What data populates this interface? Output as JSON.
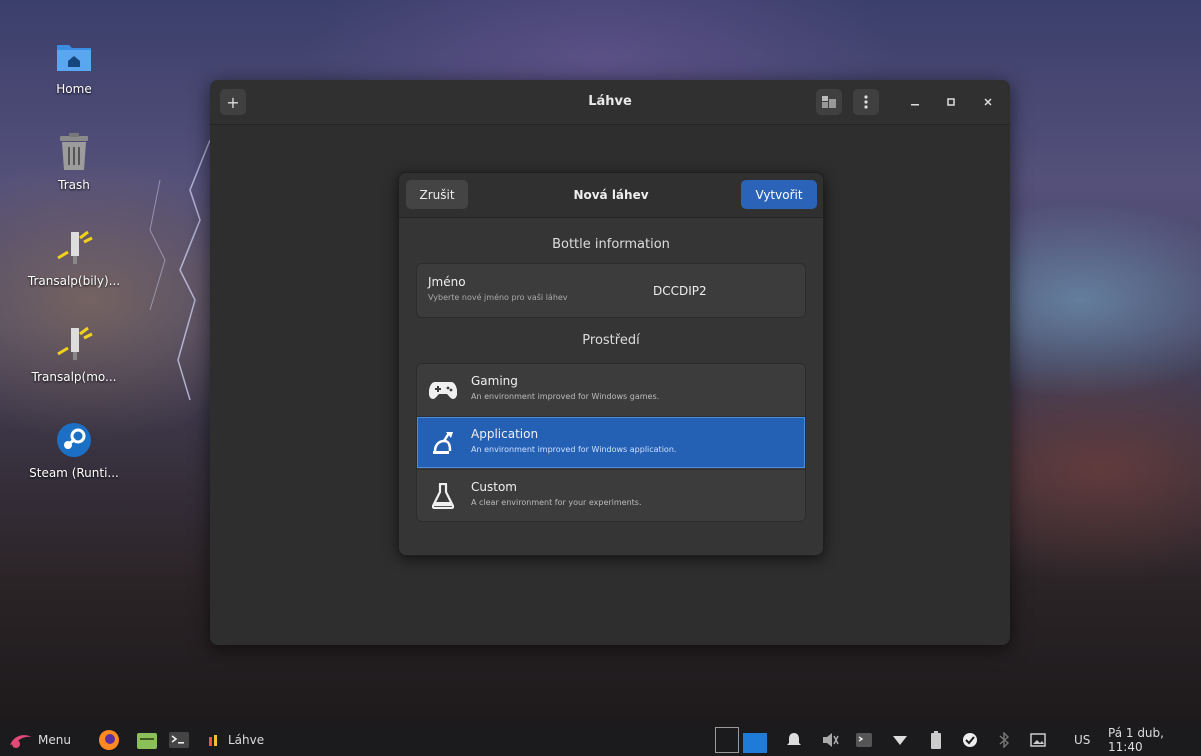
{
  "desktop": {
    "icons": [
      {
        "label": "Home",
        "icon": "home-folder-icon"
      },
      {
        "label": "Trash",
        "icon": "trash-icon"
      },
      {
        "label": "Transalp(bily)...",
        "icon": "transalp-icon"
      },
      {
        "label": "Transalp(mo...",
        "icon": "transalp-icon"
      },
      {
        "label": "Steam (Runti...",
        "icon": "steam-icon"
      }
    ]
  },
  "window": {
    "title": "Láhve",
    "add_button": "+"
  },
  "dialog": {
    "cancel_label": "Zrušit",
    "title": "Nová láhev",
    "create_label": "Vytvořit",
    "section_info": "Bottle information",
    "name_label": "Jméno",
    "name_subtitle": "Vyberte nové jméno pro vaši láhev",
    "name_value": "DCCDIP2",
    "section_env": "Prostředí",
    "environments": [
      {
        "name": "Gaming",
        "description": "An environment improved for Windows games.",
        "icon": "gamepad-icon",
        "selected": false
      },
      {
        "name": "Application",
        "description": "An environment improved for Windows application.",
        "icon": "desk-lamp-icon",
        "selected": true
      },
      {
        "name": "Custom",
        "description": "A clear environment for your experiments.",
        "icon": "flask-icon",
        "selected": false
      }
    ]
  },
  "taskbar": {
    "menu_label": "Menu",
    "task_label": "Láhve",
    "keyboard_layout": "US",
    "clock": "Pá 1 dub, 11:40"
  },
  "colors": {
    "accent": "#2a63b8",
    "selected_row": "#2460b4"
  }
}
